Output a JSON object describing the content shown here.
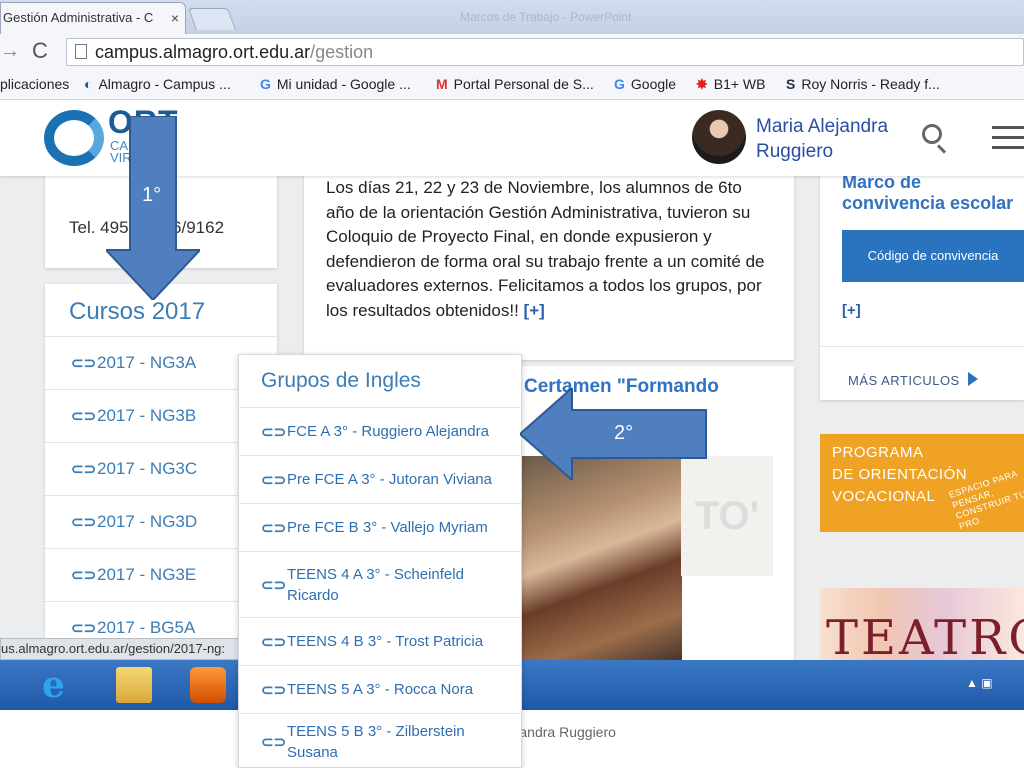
{
  "browser": {
    "tab_title": "Gestión Administrativa - C",
    "tab_close": "×",
    "window_title": "Marcos de Trabajo - PowerPoint",
    "address": {
      "host": "campus.almagro.ort.edu.ar",
      "path": "/gestion"
    },
    "bookmarks": [
      {
        "icon": "apps-icon",
        "label": "plicaciones"
      },
      {
        "icon": "almagro-icon",
        "label": "Almagro - Campus ..."
      },
      {
        "icon": "google-icon",
        "label": "Mi unidad - Google ..."
      },
      {
        "icon": "gmail-icon",
        "label": "Portal Personal de S..."
      },
      {
        "icon": "google-icon",
        "label": "Google"
      },
      {
        "icon": "b1-icon",
        "label": "B1+ WB"
      },
      {
        "icon": "rn-icon",
        "label": "Roy Norris - Ready f..."
      }
    ]
  },
  "header": {
    "logo_ort": "ORT",
    "logo_campus": "CAMPUS VIRTUAL",
    "user_name_line1": "Maria Alejandra",
    "user_name_line2": "Ruggiero"
  },
  "contact": {
    "tel": "Tel. 4958-2946/9162"
  },
  "courses": {
    "title": "Cursos 2017",
    "items": [
      "2017 - NG3A",
      "2017 - NG3B",
      "2017 - NG3C",
      "2017 - NG3D",
      "2017 - NG3E",
      "2017 - BG5A"
    ]
  },
  "news": {
    "text": "Los días 21, 22 y 23 de Noviembre, los alumnos de 6to año de la orientación Gestión Administrativa, tuvieron su Coloquio de Proyecto Final, en donde expusieron y defendieron de forma oral su trabajo frente a un comité de evaluadores externos. Felicitamos a todos los grupos, por los resultados obtenidos!!",
    "more": "[+]",
    "second_title": "Certamen \"Formando"
  },
  "sidebar_right": {
    "title": "Marco de convivencia escolar",
    "button": "Código de convivencia",
    "more": "[+]",
    "mas_articulos": "MÁS ARTICULOS"
  },
  "program_banner": {
    "line1": "PROGRAMA",
    "line2": "DE ORIENTACIÓN",
    "line3": "VOCACIONAL",
    "tag": "ESPACIO PARA PENSAR, CONSTRUIR TUS PRO"
  },
  "teatro_banner": {
    "text": "TEATRO"
  },
  "groups_menu": {
    "title": "Grupos de Ingles",
    "items": [
      "FCE A 3° - Ruggiero Alejandra",
      "Pre FCE A 3° - Jutoran Viviana",
      "Pre FCE B 3° - Vallejo Myriam",
      "TEENS 4 A 3° - Scheinfeld Ricardo",
      "TEENS 4 B 3° - Trost Patricia",
      "TEENS 5 A 3° - Rocca Nora",
      "TEENS 5 B 3° - Zilberstein Susana"
    ]
  },
  "status_url": "us.almagro.ort.edu.ar/gestion/2017-ng:",
  "annotations": {
    "arrow1": "1°",
    "arrow2": "2°"
  },
  "footer": {
    "text": "Marina Garguelo- Alejandra Ruggiero"
  },
  "colors": {
    "accent": "#3c7db6",
    "button": "#2a73bf",
    "arrow_fill": "#4f7fbf",
    "banner": "#f0a224"
  }
}
